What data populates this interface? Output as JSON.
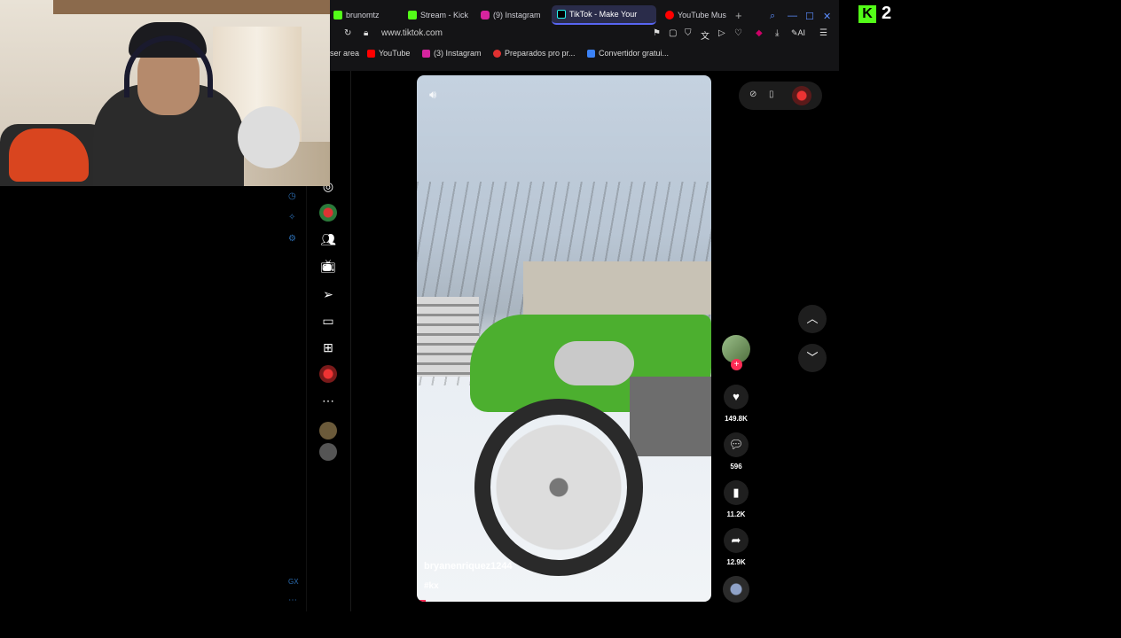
{
  "tabs": [
    {
      "label": "brunomtz",
      "icon": "kick-icon",
      "color": "#53fc18"
    },
    {
      "label": "Stream - Kick",
      "icon": "kick-icon",
      "color": "#53fc18"
    },
    {
      "label": "(9) Instagram",
      "icon": "instagram-icon",
      "color": "#d6249f"
    },
    {
      "label": "TikTok - Make Your",
      "icon": "tiktok-icon",
      "color": "#ffffff"
    },
    {
      "label": "YouTube Mus",
      "icon": "youtube-music-icon",
      "color": "#ff0000"
    }
  ],
  "address": {
    "url": "www.tiktok.com"
  },
  "bookmarks": [
    {
      "label": "ser area"
    },
    {
      "label": "YouTube",
      "color": "#ff0000"
    },
    {
      "label": "(3) Instagram",
      "color": "#d6249f"
    },
    {
      "label": "Preparados pro pr...",
      "color": "#e03131"
    },
    {
      "label": "Convertidor gratui...",
      "color": "#3b82f6"
    }
  ],
  "kick": {
    "logo": "K",
    "number": "2"
  },
  "video": {
    "username": "bryanenriquez1244",
    "hashtag": "#kx",
    "progress": 0.03
  },
  "actions": {
    "likes": "149.8K",
    "comments": "596",
    "saves": "11.2K",
    "shares": "12.9K"
  },
  "opera_sidebar": {
    "gx_label": "GX"
  },
  "colors": {
    "tiktok_red": "#fe2c55",
    "kick_green": "#53fc18"
  }
}
